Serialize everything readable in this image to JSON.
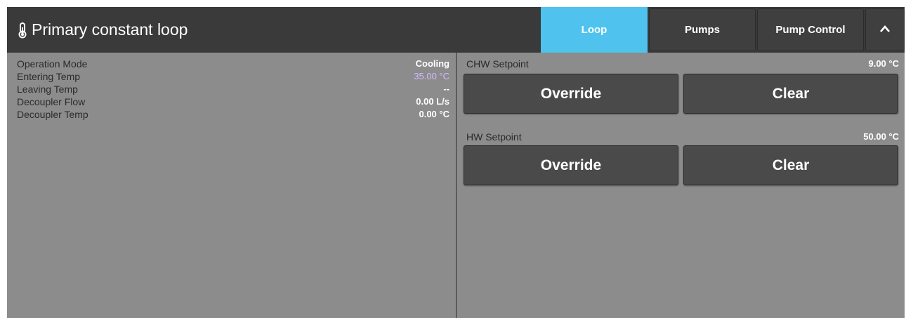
{
  "header": {
    "icon": "thermometer-icon",
    "title": "Primary constant loop"
  },
  "tabs": {
    "loop": "Loop",
    "pumps": "Pumps",
    "pump_control": "Pump Control",
    "collapse_icon": "chevron-up-icon",
    "active": "Loop"
  },
  "status": {
    "operation_mode": {
      "label": "Operation Mode",
      "value": "Cooling"
    },
    "entering_temp": {
      "label": "Entering Temp",
      "value": "35.00 °C"
    },
    "leaving_temp": {
      "label": "Leaving Temp",
      "value": "--"
    },
    "decoupler_flow": {
      "label": "Decoupler Flow",
      "value": "0.00 L/s"
    },
    "decoupler_temp": {
      "label": "Decoupler Temp",
      "value": "0.00 °C"
    }
  },
  "setpoints": {
    "chw": {
      "label": "CHW Setpoint",
      "value": "9.00 °C",
      "override": "Override",
      "clear": "Clear"
    },
    "hw": {
      "label": "HW Setpoint",
      "value": "50.00 °C",
      "override": "Override",
      "clear": "Clear"
    }
  },
  "colors": {
    "accent": "#4fc3ee",
    "header_bg": "#3a3a3a",
    "panel_bg": "#8c8c8c",
    "highlight_value": "#d4b8ff"
  }
}
